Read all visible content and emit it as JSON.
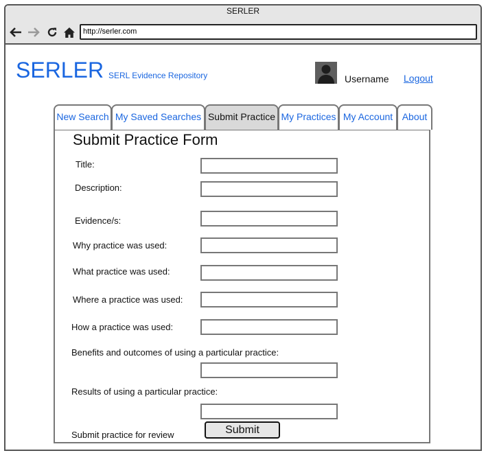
{
  "browser": {
    "window_title": "SERLER",
    "address": "http://serler.com"
  },
  "header": {
    "brand": "SERLER",
    "tagline": "SERL Evidence Repository",
    "username": "Username",
    "logout_label": "Logout"
  },
  "tabs": [
    {
      "label": "New Search",
      "active": false
    },
    {
      "label": "My Saved Searches",
      "active": false
    },
    {
      "label": "Submit Practice",
      "active": true
    },
    {
      "label": "My Practices",
      "active": false
    },
    {
      "label": "My Account",
      "active": false
    },
    {
      "label": "About",
      "active": false
    }
  ],
  "form": {
    "title": "Submit Practice Form",
    "fields": {
      "title": {
        "label": "Title:",
        "value": ""
      },
      "description": {
        "label": "Description:",
        "value": ""
      },
      "evidence": {
        "label": "Evidence/s:",
        "value": ""
      },
      "why": {
        "label": "Why practice was used:",
        "value": ""
      },
      "what": {
        "label": "What practice was used:",
        "value": ""
      },
      "where": {
        "label": "Where a practice was used:",
        "value": ""
      },
      "how": {
        "label": "How a practice was used:",
        "value": ""
      },
      "benefits": {
        "label": "Benefits and outcomes of using a particular practice:",
        "value": ""
      },
      "results": {
        "label": "Results of using a particular practice:",
        "value": ""
      }
    },
    "submit_prompt": "Submit practice for review",
    "submit_label": "Submit"
  },
  "colors": {
    "link": "#1a66e0",
    "active_tab": "#d9d9d9",
    "chrome": "#e6e6e6"
  }
}
